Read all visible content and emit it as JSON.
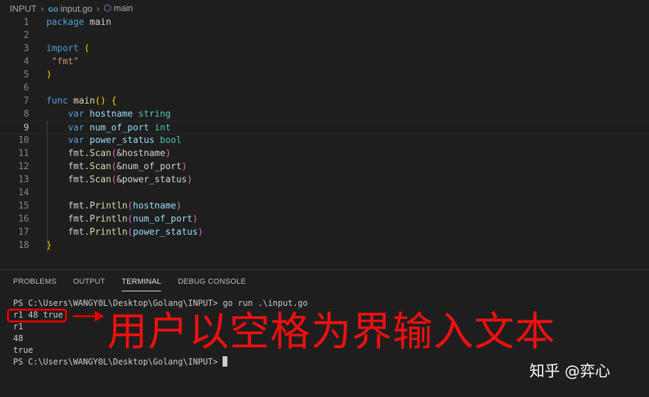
{
  "breadcrumb": {
    "folder": "INPUT",
    "file": "input.go",
    "file_icon": "GO",
    "symbol": "main",
    "separator": "›"
  },
  "editor": {
    "current_line": 9,
    "lines": [
      {
        "n": "1"
      },
      {
        "n": "2"
      },
      {
        "n": "3"
      },
      {
        "n": "4"
      },
      {
        "n": "5"
      },
      {
        "n": "6"
      },
      {
        "n": "7"
      },
      {
        "n": "8"
      },
      {
        "n": "9"
      },
      {
        "n": "10"
      },
      {
        "n": "11"
      },
      {
        "n": "12"
      },
      {
        "n": "13"
      },
      {
        "n": "14"
      },
      {
        "n": "15"
      },
      {
        "n": "16"
      },
      {
        "n": "17"
      },
      {
        "n": "18"
      }
    ],
    "tokens": {
      "package": "package",
      "main": "main",
      "import": "import",
      "lparen": "(",
      "fmt_str": "\"fmt\"",
      "rparen": ")",
      "func": "func",
      "main_fn": "main",
      "parens": "()",
      "lbrace": "{",
      "rbrace": "}",
      "var": "var",
      "hostname": "hostname",
      "string": "string",
      "num_of_port": "num_of_port",
      "int": "int",
      "power_status": "power_status",
      "bool": "bool",
      "fmt": "fmt",
      "dot": ".",
      "scan": "Scan",
      "println": "Println",
      "amp_hostname": "&hostname",
      "amp_num_of_port": "&num_of_port",
      "amp_power_status": "&power_status"
    }
  },
  "panel": {
    "tabs": [
      "PROBLEMS",
      "OUTPUT",
      "TERMINAL",
      "DEBUG CONSOLE"
    ],
    "active_tab": "TERMINAL",
    "terminal": [
      "PS C:\\Users\\WANGY0L\\Desktop\\Golang\\INPUT> go run .\\input.go",
      "r1 48 true",
      "r1",
      "48",
      "true",
      "PS C:\\Users\\WANGY0L\\Desktop\\Golang\\INPUT> "
    ]
  },
  "annotation": {
    "text": "用户以空格为界输入文本",
    "color": "#ee1010"
  },
  "watermark": "知乎 @弈心",
  "colors": {
    "background": "#1e1e1e",
    "keyword": "#569cd6",
    "identifier": "#9cdcfe",
    "type": "#4ec9b0",
    "function": "#dcdcaa",
    "string": "#ce9178",
    "annotation_red": "#e00000"
  }
}
